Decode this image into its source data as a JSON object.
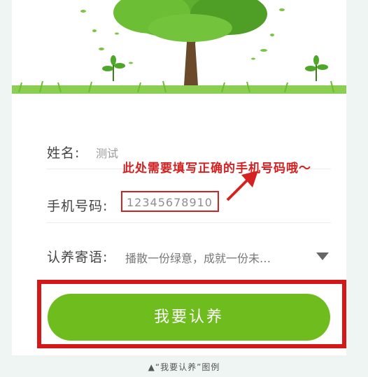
{
  "form": {
    "name_label": "姓名:",
    "name_value": "测试",
    "phone_label": "手机号码:",
    "phone_value": "12345678910",
    "message_label": "认养寄语:",
    "message_value": "播散一份绿意，成就一份未…",
    "message_icon": "chevron-down-icon"
  },
  "annotation": {
    "text": "此处需要填写正确的手机号码哦～",
    "color": "#d42222"
  },
  "submit": {
    "label": "我要认养",
    "color": "#6ebc1d"
  },
  "caption": "▲“我要认养”图例"
}
